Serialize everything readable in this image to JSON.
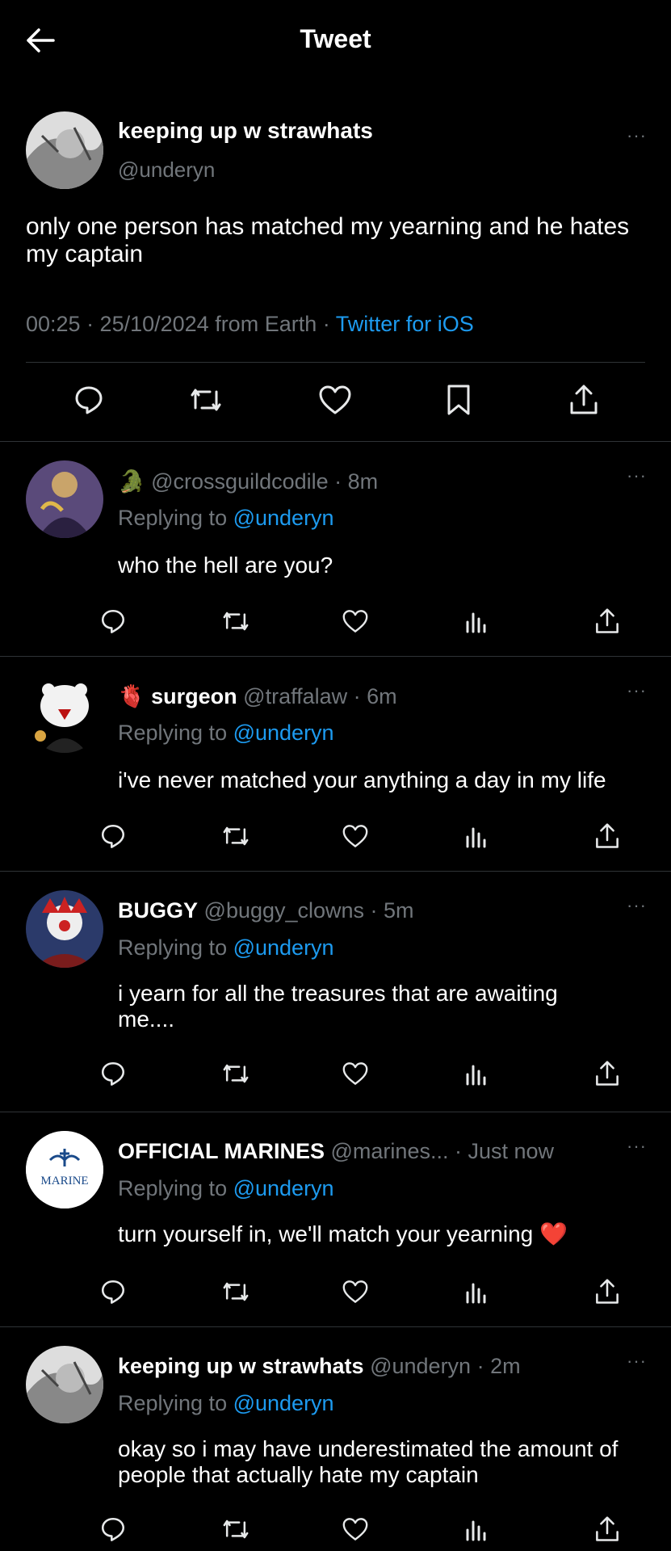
{
  "header": {
    "title": "Tweet"
  },
  "main_tweet": {
    "name": "keeping up w strawhats",
    "handle": "@underyn",
    "text": "only one person has matched my yearning and he hates my captain",
    "time": "00:25 · 25/10/2024 from Earth · ",
    "source": "Twitter for iOS",
    "more": "···"
  },
  "replies": [
    {
      "emoji": "🐊",
      "name": "",
      "handle": "@crossguildcodile · 8m",
      "replying_label": "Replying to ",
      "replying_to": "@underyn",
      "text": "who the hell are you?",
      "more": "···"
    },
    {
      "emoji": "🫀",
      "name": "surgeon",
      "handle": "@traffalaw · 6m",
      "replying_label": "Replying to ",
      "replying_to": "@underyn",
      "text": "i've never matched your anything a day in my life",
      "more": "···"
    },
    {
      "emoji": "",
      "name": "BUGGY",
      "handle": "@buggy_clowns · 5m",
      "replying_label": "Replying to ",
      "replying_to": "@underyn",
      "text": "i yearn for all the treasures that are awaiting me....",
      "more": "···"
    },
    {
      "emoji": "",
      "name": "OFFICIAL MARINES",
      "handle": "@marines... · Just now",
      "replying_label": "Replying to ",
      "replying_to": "@underyn",
      "text": "turn yourself in, we'll match your yearning ❤️",
      "more": "···",
      "avatar_text": "MARINE"
    },
    {
      "emoji": "",
      "name": "keeping up w strawhats",
      "handle": "@underyn · 2m",
      "replying_label": "Replying to ",
      "replying_to": "@underyn",
      "text": "okay so i may have underestimated the amount of people that actually hate my captain",
      "more": "···"
    }
  ],
  "icons": {
    "back": "arrow-left-icon",
    "reply": "reply-icon",
    "retweet": "retweet-icon",
    "like": "heart-icon",
    "bookmark": "bookmark-icon",
    "views": "views-icon",
    "share": "share-icon"
  },
  "colors": {
    "background": "#000000",
    "text": "#e7e9ea",
    "muted": "#71767b",
    "accent": "#1d9bf0",
    "divider": "#2f3336"
  }
}
